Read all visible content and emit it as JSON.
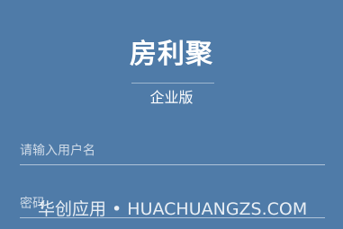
{
  "brand": {
    "logo_text": "房利聚",
    "edition": "企业版"
  },
  "login_form": {
    "username_placeholder": "请输入用户名",
    "password_placeholder": "密码"
  },
  "watermark": {
    "text": "华创应用 • HUACHUANGZS.COM"
  },
  "colors": {
    "background": "#4f7ba8",
    "text": "#ffffff"
  }
}
